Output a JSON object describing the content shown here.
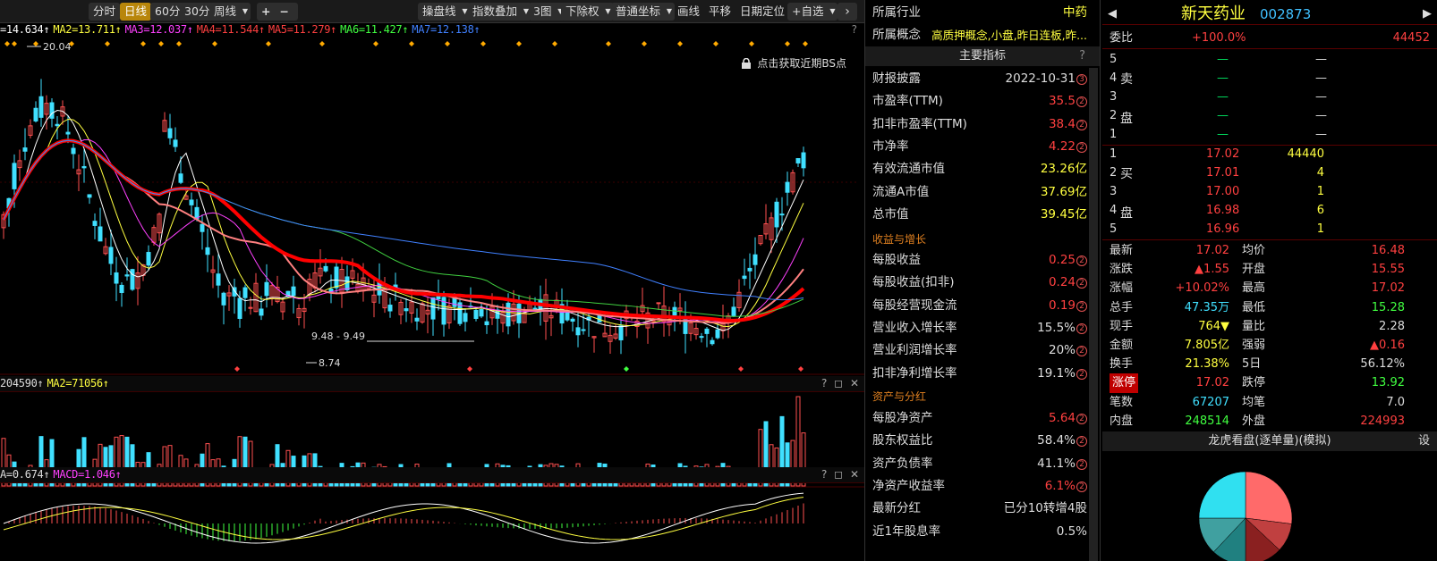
{
  "toolbar": {
    "time": "分时",
    "day": "日线",
    "m60": "60分",
    "m30": "30分",
    "week": "周线",
    "plus": "+",
    "minus": "−",
    "mainline": "操盘线",
    "index": "指数叠加",
    "fig": "3图",
    "rights": "下除权",
    "coord": "普通坐标",
    "draw": "画线",
    "pan": "平移",
    "locate": "日期定位",
    "watch": "+自选"
  },
  "kline": {
    "ma_labels": [
      "=14.634↑",
      "MA2=13.711↑",
      "MA3=12.037↑",
      "MA4=11.544↑",
      "MA5=11.279↑",
      "MA6=11.427↑",
      "MA7=12.138↑"
    ],
    "ma_colors": [
      "#ffffff",
      "#ffff40",
      "#ff40ff",
      "#ff4040",
      "#ff4040",
      "#40ff40",
      "#4080ff"
    ],
    "high_label": "20.04",
    "low_label": "8.74",
    "range_label": "9.48 - 9.49",
    "bs_hint": "点击获取近期BS点",
    "qmark": "?"
  },
  "volume": {
    "label1": "204590↑",
    "label2": "MA2=71056↑",
    "qmark": "? ◻ ✕"
  },
  "macd": {
    "label1": "A=0.674↑",
    "label2": "MACD=1.046↑",
    "qmark": "? ◻ ✕"
  },
  "info": {
    "industry_k": "所属行业",
    "industry_v": "中药",
    "concept_k": "所属概念",
    "concept_v": "高质押概念,小盘,昨日连板,昨...",
    "header": "主要指标",
    "rows": [
      {
        "k": "财报披露",
        "v": "2022-10-31",
        "n": "3",
        "c": "#ddd"
      },
      {
        "k": "市盈率(TTM)",
        "v": "35.5",
        "n": "2",
        "c": "#ff4040"
      },
      {
        "k": "扣非市盈率(TTM)",
        "v": "38.4",
        "n": "2",
        "c": "#ff4040"
      },
      {
        "k": "市净率",
        "v": "4.22",
        "n": "2",
        "c": "#ff4040"
      },
      {
        "k": "有效流通市值",
        "v": "23.26亿",
        "n": "",
        "c": "#ffff40"
      },
      {
        "k": "流通A市值",
        "v": "37.69亿",
        "n": "",
        "c": "#ffff40"
      },
      {
        "k": "总市值",
        "v": "39.45亿",
        "n": "",
        "c": "#ffff40"
      }
    ],
    "sect1": "收益与增长",
    "rows2": [
      {
        "k": "每股收益",
        "v": "0.25",
        "n": "2",
        "c": "#ff4040"
      },
      {
        "k": "每股收益(扣非)",
        "v": "0.24",
        "n": "2",
        "c": "#ff4040"
      },
      {
        "k": "每股经营现金流",
        "v": "0.19",
        "n": "2",
        "c": "#ff4040"
      },
      {
        "k": "营业收入增长率",
        "v": "15.5%",
        "n": "2",
        "c": "#ddd"
      },
      {
        "k": "营业利润增长率",
        "v": "20%",
        "n": "2",
        "c": "#ddd"
      },
      {
        "k": "扣非净利增长率",
        "v": "19.1%",
        "n": "2",
        "c": "#ddd"
      }
    ],
    "sect2": "资产与分红",
    "rows3": [
      {
        "k": "每股净资产",
        "v": "5.64",
        "n": "2",
        "c": "#ff4040"
      },
      {
        "k": "股东权益比",
        "v": "58.4%",
        "n": "2",
        "c": "#ddd"
      },
      {
        "k": "资产负债率",
        "v": "41.1%",
        "n": "2",
        "c": "#ddd"
      },
      {
        "k": "净资产收益率",
        "v": "6.1%",
        "n": "2",
        "c": "#ff4040"
      },
      {
        "k": "最新分红",
        "v": "已分10转增4股",
        "n": "",
        "c": "#ddd"
      },
      {
        "k": "近1年股息率",
        "v": "0.5%",
        "n": "",
        "c": "#ddd"
      }
    ]
  },
  "quote": {
    "name": "新天药业",
    "code": "002873",
    "weibi_k": "委比",
    "weibi_v": "+100.0%",
    "weibi_n": "44452",
    "sell_label": [
      "卖",
      "盘"
    ],
    "buy_label": [
      "买",
      "盘"
    ],
    "sell": [
      {
        "i": "5",
        "p": "—",
        "v": "—"
      },
      {
        "i": "4",
        "p": "—",
        "v": "—"
      },
      {
        "i": "3",
        "p": "—",
        "v": "—"
      },
      {
        "i": "2",
        "p": "—",
        "v": "—"
      },
      {
        "i": "1",
        "p": "—",
        "v": "—"
      }
    ],
    "buy": [
      {
        "i": "1",
        "p": "17.02",
        "v": "44440"
      },
      {
        "i": "2",
        "p": "17.01",
        "v": "4"
      },
      {
        "i": "3",
        "p": "17.00",
        "v": "1"
      },
      {
        "i": "4",
        "p": "16.98",
        "v": "6"
      },
      {
        "i": "5",
        "p": "16.96",
        "v": "1"
      }
    ],
    "stats": [
      {
        "k1": "最新",
        "v1": "17.02",
        "c1": "#ff4040",
        "k2": "均价",
        "v2": "16.48",
        "c2": "#ff4040"
      },
      {
        "k1": "涨跌",
        "v1": "▲1.55",
        "c1": "#ff4040",
        "k2": "开盘",
        "v2": "15.55",
        "c2": "#ff4040"
      },
      {
        "k1": "涨幅",
        "v1": "+10.02%",
        "c1": "#ff4040",
        "k2": "最高",
        "v2": "17.02",
        "c2": "#ff4040"
      },
      {
        "k1": "总手",
        "v1": "47.35万",
        "c1": "#40e0ff",
        "k2": "最低",
        "v2": "15.28",
        "c2": "#40ff40"
      },
      {
        "k1": "现手",
        "v1": "764▼",
        "c1": "#ffff40",
        "k2": "量比",
        "v2": "2.28",
        "c2": "#ddd"
      },
      {
        "k1": "金额",
        "v1": "7.805亿",
        "c1": "#ffff40",
        "k2": "强弱",
        "v2": "▲0.16",
        "c2": "#ff4040"
      },
      {
        "k1": "换手",
        "v1": "21.38%",
        "c1": "#ffff40",
        "k2": "5日",
        "v2": "56.12%",
        "c2": "#ddd"
      },
      {
        "k1": "涨停",
        "v1": "17.02",
        "c1": "#ff4040",
        "k2": "跌停",
        "v2": "13.92",
        "c2": "#40ff40"
      },
      {
        "k1": "笔数",
        "v1": "67207",
        "c1": "#40e0ff",
        "k2": "均笔",
        "v2": "7.0",
        "c2": "#ddd"
      },
      {
        "k1": "内盘",
        "v1": "248514",
        "c1": "#40ff40",
        "k2": "外盘",
        "v2": "224993",
        "c2": "#ff4040"
      }
    ],
    "lhb_title": "龙虎看盘(逐单量)(模拟)",
    "lhb_set": "设",
    "pie_colors": [
      "#ff6a6a",
      "#c04040",
      "#8a2020",
      "#208080",
      "#40a0a0",
      "#30e0f0"
    ]
  }
}
